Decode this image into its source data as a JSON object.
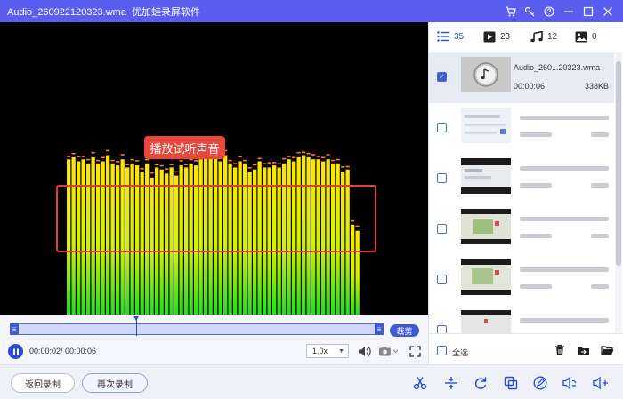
{
  "window": {
    "filename": "Audio_260922120323.wma",
    "app_name": "优加蛙录屏软件",
    "controls": [
      "cart-icon",
      "key-icon",
      "help-icon",
      "minimize-icon",
      "maximize-icon",
      "close-icon"
    ]
  },
  "player": {
    "caption": "播放试听声音",
    "bars": [
      0.76,
      0.77,
      0.75,
      0.76,
      0.74,
      0.77,
      0.74,
      0.75,
      0.78,
      0.74,
      0.73,
      0.76,
      0.72,
      0.74,
      0.73,
      0.7,
      0.74,
      0.67,
      0.72,
      0.71,
      0.69,
      0.72,
      0.68,
      0.73,
      0.72,
      0.74,
      0.73,
      0.76,
      0.77,
      0.78,
      0.77,
      0.75,
      0.78,
      0.74,
      0.72,
      0.75,
      0.74,
      0.7,
      0.71,
      0.75,
      0.72,
      0.72,
      0.73,
      0.72,
      0.74,
      0.76,
      0.75,
      0.77,
      0.78,
      0.77,
      0.76,
      0.76,
      0.75,
      0.76,
      0.74,
      0.74,
      0.7,
      0.71,
      0.44,
      0.41
    ],
    "accent_color": "#ffe600"
  },
  "timeline": {
    "trim_label": "裁剪",
    "progress": 0.35
  },
  "controls": {
    "time": "00:00:02/ 00:00:06",
    "speed": "1.0x"
  },
  "bottom": {
    "back_label": "返回录制",
    "again_label": "再次录制",
    "tools": [
      "scissors-icon",
      "split-icon",
      "rotate-icon",
      "merge-icon",
      "edit-icon",
      "volume-change-icon",
      "audio-add-icon"
    ]
  },
  "panel": {
    "tabs": [
      {
        "icon": "list-icon",
        "count": "35"
      },
      {
        "icon": "video-icon",
        "count": "23"
      },
      {
        "icon": "music-icon",
        "count": "12"
      },
      {
        "icon": "image-icon",
        "count": "0"
      }
    ],
    "selected_item": {
      "name": "Audio_260...20323.wma",
      "duration": "00:00:06",
      "size": "338KB"
    },
    "select_all_label": "全选"
  }
}
